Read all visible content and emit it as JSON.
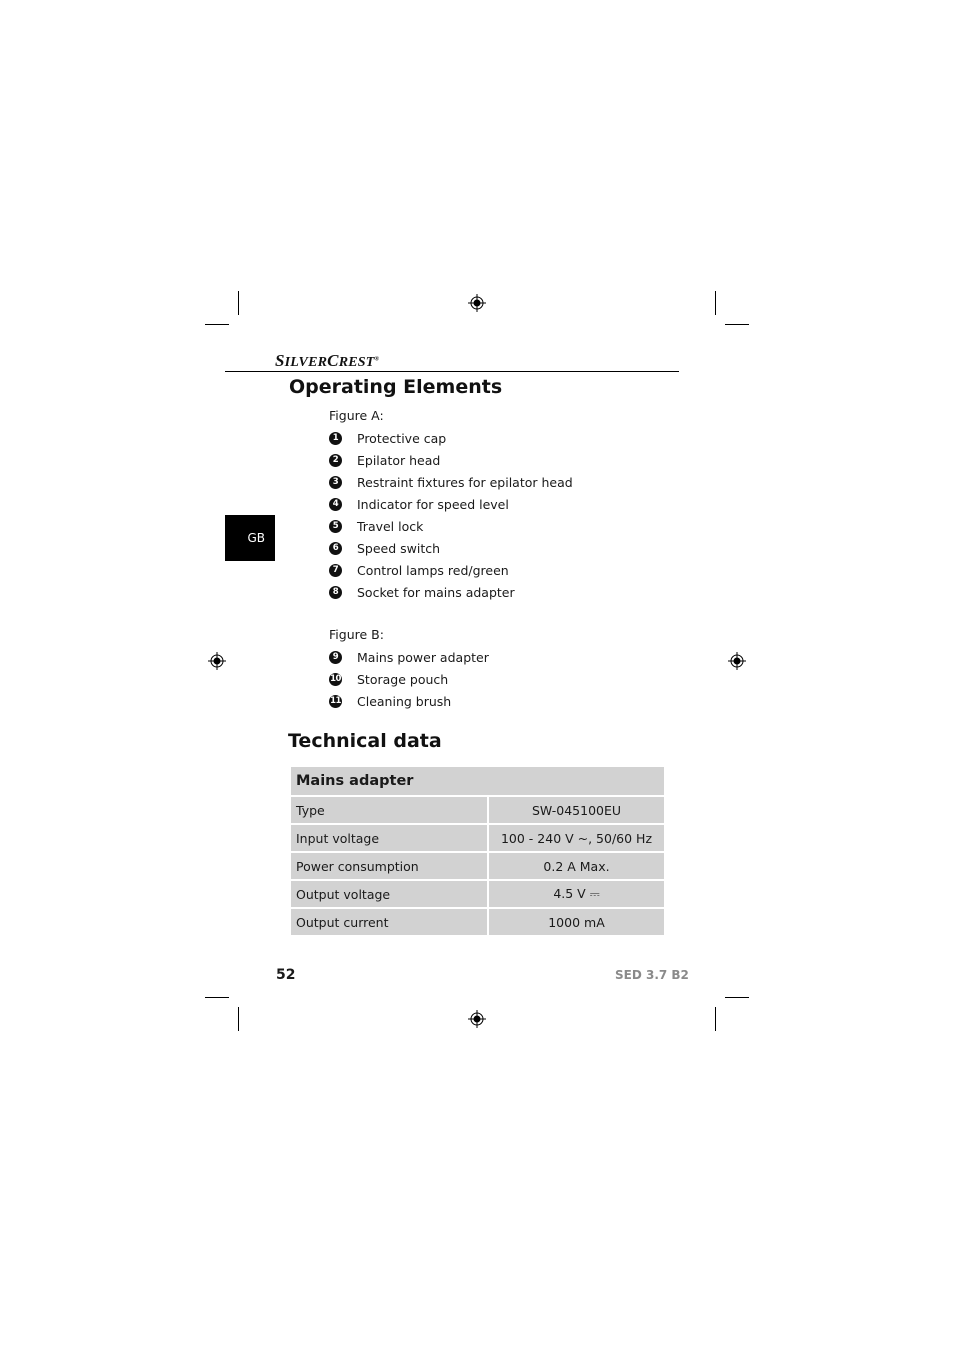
{
  "header": {
    "brand_small": "S",
    "brand_rest1": "ILVER",
    "brand_c": "C",
    "brand_rest2": "REST",
    "brand_mark": "®"
  },
  "operating_elements": {
    "title": "Operating Elements",
    "figure_a": {
      "label": "Figure A:",
      "items": [
        {
          "num": "1",
          "label": "Protective cap"
        },
        {
          "num": "2",
          "label": "Epilator head"
        },
        {
          "num": "3",
          "label": "Restraint fixtures for epilator head"
        },
        {
          "num": "4",
          "label": "Indicator for speed level"
        },
        {
          "num": "5",
          "label": "Travel lock"
        },
        {
          "num": "6",
          "label": "Speed switch"
        },
        {
          "num": "7",
          "label": "Control lamps red/green"
        },
        {
          "num": "8",
          "label": "Socket for mains adapter"
        }
      ]
    },
    "figure_b": {
      "label": "Figure B:",
      "items": [
        {
          "num": "9",
          "label": "Mains power adapter"
        },
        {
          "num": "10",
          "label": "Storage pouch"
        },
        {
          "num": "11",
          "label": "Cleaning brush"
        }
      ]
    }
  },
  "language_tab": "GB",
  "technical_data": {
    "title": "Technical data",
    "table_header": "Mains adapter",
    "rows": [
      {
        "label": "Type",
        "value": "SW-045100EU"
      },
      {
        "label": "Input voltage",
        "value": "100 - 240 V ~, 50/60 Hz"
      },
      {
        "label": "Power consumption",
        "value": "0.2 A Max."
      },
      {
        "label": "Output voltage",
        "value": "4.5 V ⎓"
      },
      {
        "label": "Output current",
        "value": "1000 mA"
      }
    ]
  },
  "footer": {
    "page_number": "52",
    "model": "SED 3.7 B2"
  }
}
